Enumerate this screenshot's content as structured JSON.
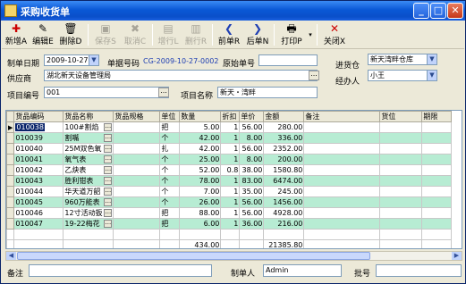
{
  "window": {
    "title": "采购收货单",
    "min": "_",
    "max": "□",
    "close": "✕"
  },
  "toolbar": [
    {
      "label": "新增A",
      "icon": "✚",
      "disabled": false
    },
    {
      "label": "编辑E",
      "icon": "✎",
      "disabled": false
    },
    {
      "label": "删除D",
      "icon": "🗑",
      "disabled": false
    },
    {
      "label": "保存S",
      "icon": "▣",
      "disabled": true
    },
    {
      "label": "取消C",
      "icon": "✖",
      "disabled": true
    },
    {
      "label": "增行L",
      "icon": "▤",
      "disabled": true
    },
    {
      "label": "删行R",
      "icon": "▥",
      "disabled": true
    },
    {
      "label": "前单R",
      "icon": "❮",
      "disabled": false
    },
    {
      "label": "后单N",
      "icon": "❯",
      "disabled": false
    },
    {
      "label": "打印P",
      "icon": "🖶",
      "disabled": false
    },
    {
      "label": "关闭X",
      "icon": "✕",
      "disabled": false
    }
  ],
  "form": {
    "date_label": "制单日期",
    "date_value": "2009-10-27",
    "docno_label": "单据号码",
    "docno_value": "CG-2009-10-27-0002",
    "orig_label": "原始单号",
    "orig_value": "",
    "warehouse_label": "进货仓",
    "warehouse_value": "新天湾畔仓库",
    "supplier_label": "供应商",
    "supplier_value": "湖北新天设备管理局",
    "handler_label": "经办人",
    "handler_value": "小王",
    "projno_label": "项目编号",
    "projno_value": "001",
    "projname_label": "项目名称",
    "projname_value": "新天・湾畔"
  },
  "grid": {
    "columns": [
      "货品编码",
      "货品名称",
      "货品规格",
      "单位",
      "数量",
      "折扣",
      "单价",
      "金额",
      "备注",
      "货位",
      "期限"
    ],
    "rows": [
      {
        "code": "010038",
        "name": "100#割焰",
        "spec": "",
        "unit": "把",
        "qty": "5.00",
        "disc": "1",
        "price": "56.00",
        "amount": "280.00"
      },
      {
        "code": "010039",
        "name": "割嘴",
        "spec": "",
        "unit": "个",
        "qty": "42.00",
        "disc": "1",
        "price": "8.00",
        "amount": "336.00"
      },
      {
        "code": "010040",
        "name": "25M双色氧",
        "spec": "",
        "unit": "扎",
        "qty": "42.00",
        "disc": "1",
        "price": "56.00",
        "amount": "2352.00"
      },
      {
        "code": "010041",
        "name": "氧气表",
        "spec": "",
        "unit": "个",
        "qty": "25.00",
        "disc": "1",
        "price": "8.00",
        "amount": "200.00"
      },
      {
        "code": "010042",
        "name": "乙炔表",
        "spec": "",
        "unit": "个",
        "qty": "52.00",
        "disc": "0.8",
        "price": "38.00",
        "amount": "1580.80"
      },
      {
        "code": "010043",
        "name": "胜利钳表",
        "spec": "",
        "unit": "个",
        "qty": "78.00",
        "disc": "1",
        "price": "83.00",
        "amount": "6474.00"
      },
      {
        "code": "010044",
        "name": "华天道万韶",
        "spec": "",
        "unit": "个",
        "qty": "7.00",
        "disc": "1",
        "price": "35.00",
        "amount": "245.00"
      },
      {
        "code": "010045",
        "name": "960万能表",
        "spec": "",
        "unit": "个",
        "qty": "26.00",
        "disc": "1",
        "price": "56.00",
        "amount": "1456.00"
      },
      {
        "code": "010046",
        "name": "12寸活动扳",
        "spec": "",
        "unit": "把",
        "qty": "88.00",
        "disc": "1",
        "price": "56.00",
        "amount": "4928.00"
      },
      {
        "code": "010047",
        "name": "19-22梅花",
        "spec": "",
        "unit": "把",
        "qty": "6.00",
        "disc": "1",
        "price": "36.00",
        "amount": "216.00"
      }
    ],
    "total_qty": "434.00",
    "total_amount": "21385.80"
  },
  "footer": {
    "remark_label": "备注",
    "remark_value": "",
    "maker_label": "制单人",
    "maker_value": "Admin",
    "batch_label": "批号",
    "batch_value": ""
  }
}
